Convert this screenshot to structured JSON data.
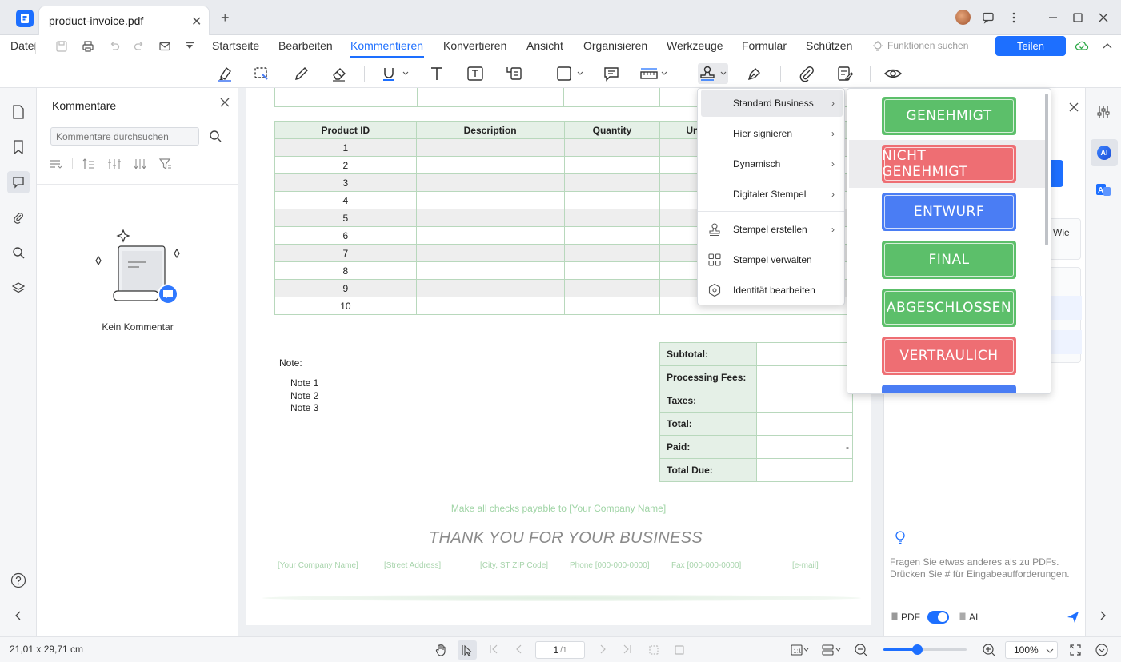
{
  "titlebar": {
    "tab_title": "product-invoice.pdf",
    "tab_close": "✕",
    "new_tab": "+"
  },
  "menubar": {
    "file": "Datei",
    "items": [
      "Startseite",
      "Bearbeiten",
      "Kommentieren",
      "Konvertieren",
      "Ansicht",
      "Organisieren",
      "Werkzeuge",
      "Formular",
      "Schützen"
    ],
    "active": "Kommentieren",
    "feature_search": "Funktionen suchen",
    "share": "Teilen"
  },
  "comments_panel": {
    "title": "Kommentare",
    "search_placeholder": "Kommentare durchsuchen",
    "empty_label": "Kein Kommentar"
  },
  "invoice": {
    "columns": [
      "Product ID",
      "Description",
      "Quantity",
      "Un"
    ],
    "rows": [
      "1",
      "2",
      "3",
      "4",
      "5",
      "6",
      "7",
      "8",
      "9",
      "10"
    ],
    "note_label": "Note:",
    "notes": [
      "Note 1",
      "Note 2",
      "Note 3"
    ],
    "totals": [
      {
        "label": "Subtotal:",
        "value": ""
      },
      {
        "label": "Processing Fees:",
        "value": ""
      },
      {
        "label": "Taxes:",
        "value": ""
      },
      {
        "label": "Total:",
        "value": ""
      },
      {
        "label": "Paid:",
        "value": "-"
      },
      {
        "label": "Total Due:",
        "value": ""
      }
    ],
    "checks_payable": "Make all checks payable to [Your Company Name]",
    "thank_you": "THANK YOU FOR YOUR BUSINESS",
    "footer": [
      "[Your Company Name]",
      "[Street Address],",
      "[City, ST ZIP Code]",
      "Phone [000-000-0000]",
      "Fax [000-000-0000]",
      "[e-mail]"
    ]
  },
  "stamp_menu": {
    "items": [
      {
        "label": "Standard Business",
        "submenu": true
      },
      {
        "label": "Hier signieren",
        "submenu": true
      },
      {
        "label": "Dynamisch",
        "submenu": true
      },
      {
        "label": "Digitaler Stempel",
        "submenu": true
      },
      {
        "label": "Stempel erstellen",
        "submenu": true
      },
      {
        "label": "Stempel verwalten",
        "submenu": false
      },
      {
        "label": "Identität bearbeiten",
        "submenu": false
      }
    ]
  },
  "stamps": [
    {
      "label": "GENEHMIGT",
      "color": "#5cbf6a"
    },
    {
      "label": "NICHT GENEHMIGT",
      "color": "#ee6e73"
    },
    {
      "label": "ENTWURF",
      "color": "#4a7df4"
    },
    {
      "label": "FINAL",
      "color": "#5cbf6a"
    },
    {
      "label": "ABGESCHLOSSEN",
      "color": "#5cbf6a"
    },
    {
      "label": "VERTRAULICH",
      "color": "#ee6e73"
    }
  ],
  "ai_panel": {
    "partial_text": "Wie",
    "input_placeholder": "Fragen Sie etwas anderes als zu PDFs. Drücken Sie # für Eingabeaufforderungen.",
    "pdf_label": "PDF",
    "ai_label": "AI"
  },
  "statusbar": {
    "dimensions": "21,01 x 29,71 cm",
    "page_value": "1",
    "page_total": "/1",
    "zoom": "100%"
  },
  "colors": {
    "accent": "#1d6fff",
    "table_border": "#b8d8bc",
    "table_header": "#e5f0e7"
  }
}
